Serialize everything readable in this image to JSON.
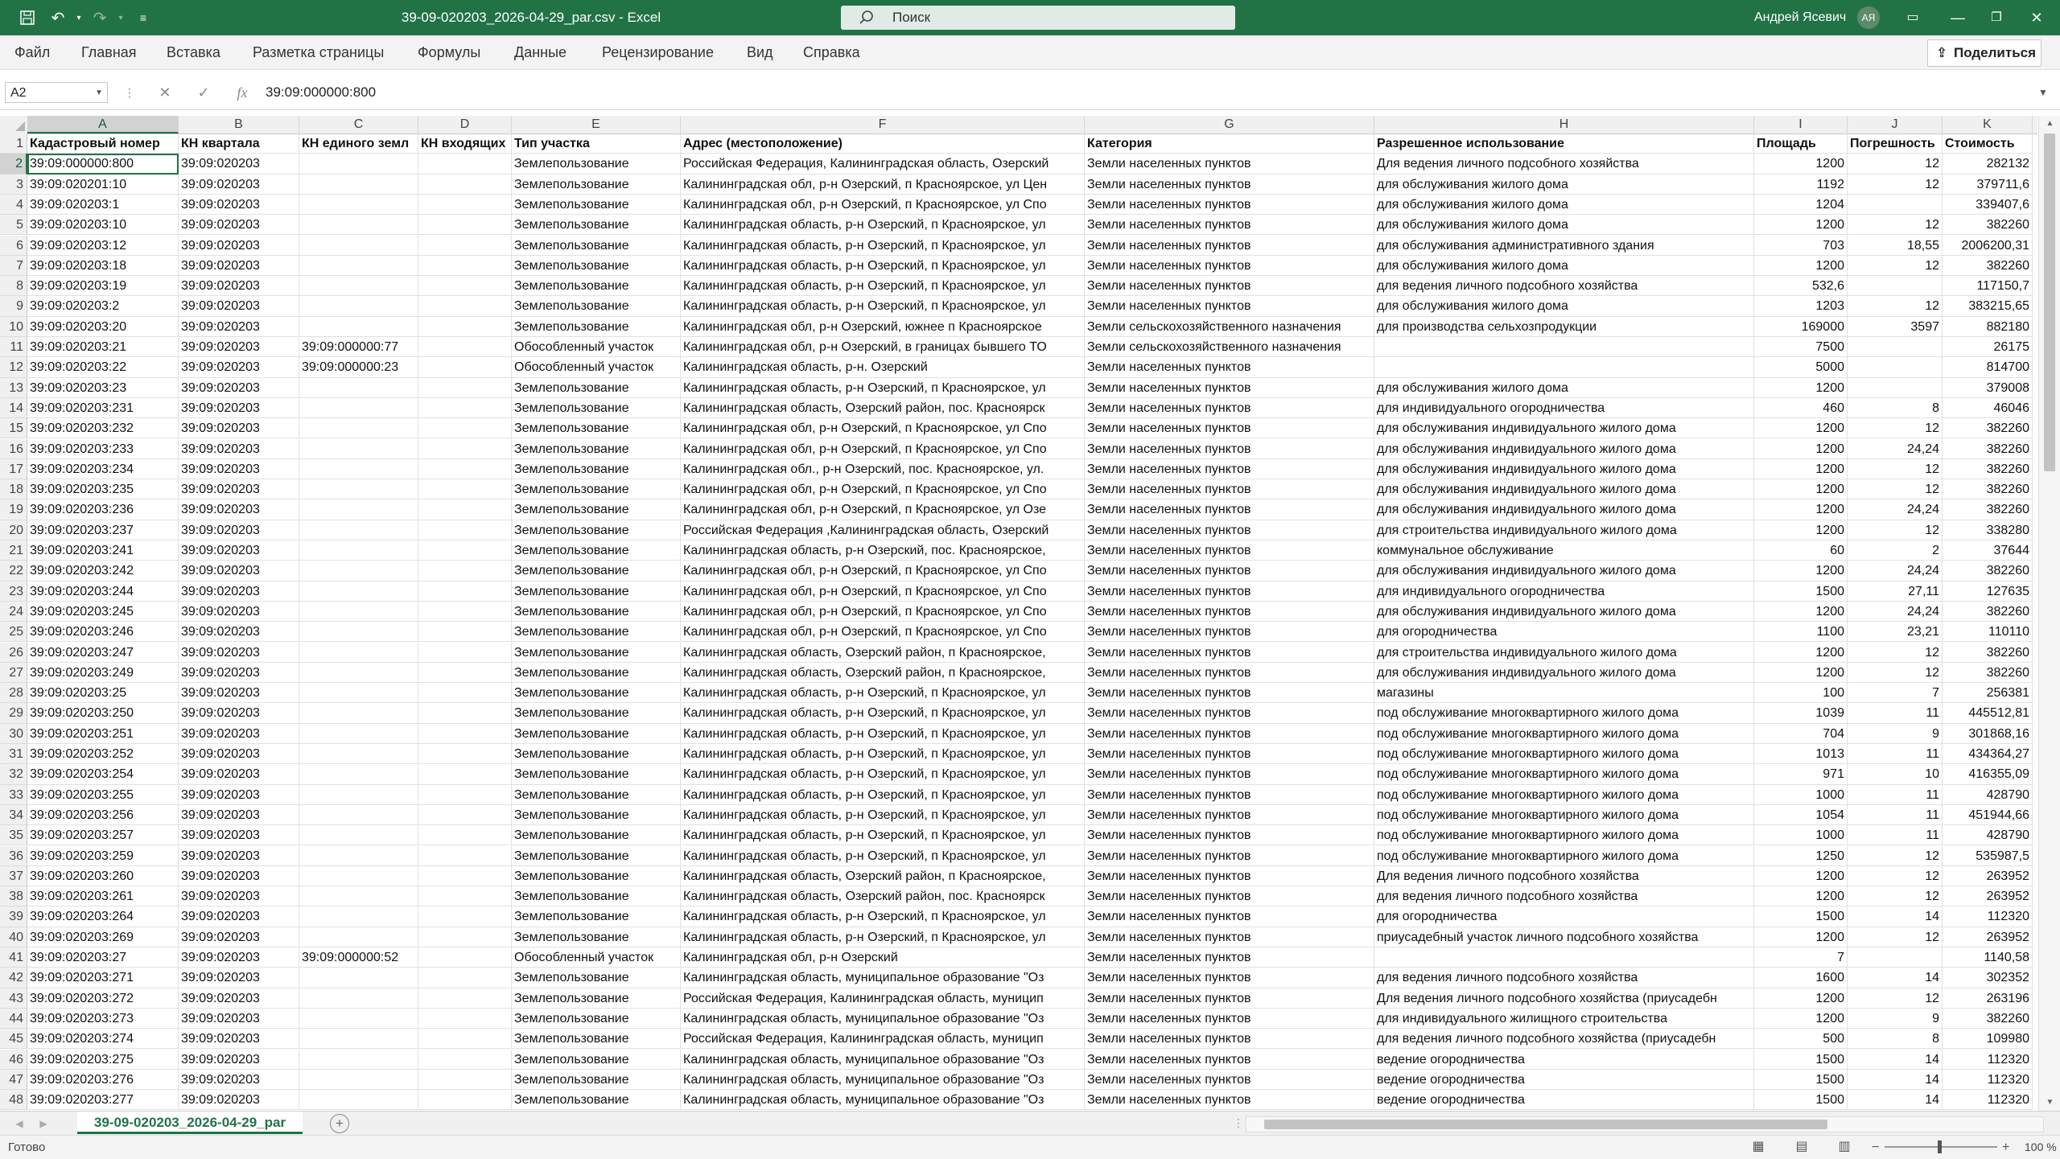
{
  "window": {
    "title": "39-09-020203_2026-04-29_par.csv  -  Excel",
    "search_placeholder": "Поиск",
    "user_name": "Андрей Ясевич",
    "user_initials": "АЯ"
  },
  "ribbon": {
    "tabs": [
      "Файл",
      "Главная",
      "Вставка",
      "Разметка страницы",
      "Формулы",
      "Данные",
      "Рецензирование",
      "Вид",
      "Справка"
    ],
    "share_label": "Поделиться"
  },
  "formula_bar": {
    "name_box": "A2",
    "formula": "39:09:000000:800"
  },
  "sheet": {
    "selected_cell": "A2",
    "columns": [
      {
        "letter": "A"
      },
      {
        "letter": "B"
      },
      {
        "letter": "C"
      },
      {
        "letter": "D"
      },
      {
        "letter": "E"
      },
      {
        "letter": "F"
      },
      {
        "letter": "G"
      },
      {
        "letter": "H"
      },
      {
        "letter": "I"
      },
      {
        "letter": "J"
      },
      {
        "letter": "K"
      }
    ],
    "header": [
      "Кадастровый номер",
      "КН квартала",
      "КН единого земл",
      "КН входящих",
      "Тип участка",
      "Адрес (местоположение)",
      "Категория",
      "Разрешенное использование",
      "Площадь",
      "Погрешность",
      "Стоимость"
    ],
    "rows": [
      [
        "39:09:000000:800",
        "39:09:020203",
        "",
        "",
        "Землепользование",
        "Российская Федерация, Калининградская область, Озерский",
        "Земли населенных пунктов",
        "Для ведения личного подсобного хозяйства",
        "1200",
        "12",
        "282132"
      ],
      [
        "39:09:020201:10",
        "39:09:020203",
        "",
        "",
        "Землепользование",
        "Калининградская обл, р-н Озерский, п Красноярское, ул Цен",
        "Земли населенных пунктов",
        "для обслуживания жилого дома",
        "1192",
        "12",
        "379711,6"
      ],
      [
        "39:09:020203:1",
        "39:09:020203",
        "",
        "",
        "Землепользование",
        "Калининградская обл, р-н Озерский, п Красноярское, ул Спо",
        "Земли населенных пунктов",
        "для обслуживания жилого дома",
        "1204",
        "",
        "339407,6"
      ],
      [
        "39:09:020203:10",
        "39:09:020203",
        "",
        "",
        "Землепользование",
        "Калининградская область, р-н Озерский, п Красноярское, ул",
        "Земли населенных пунктов",
        "для обслуживания жилого дома",
        "1200",
        "12",
        "382260"
      ],
      [
        "39:09:020203:12",
        "39:09:020203",
        "",
        "",
        "Землепользование",
        "Калининградская область, р-н Озерский, п Красноярское, ул",
        "Земли населенных пунктов",
        "для обслуживания административного здания",
        "703",
        "18,55",
        "2006200,31"
      ],
      [
        "39:09:020203:18",
        "39:09:020203",
        "",
        "",
        "Землепользование",
        "Калининградская область, р-н Озерский, п Красноярское, ул",
        "Земли населенных пунктов",
        "для обслуживания жилого дома",
        "1200",
        "12",
        "382260"
      ],
      [
        "39:09:020203:19",
        "39:09:020203",
        "",
        "",
        "Землепользование",
        "Калининградская область, р-н Озерский, п Красноярское, ул",
        "Земли населенных пунктов",
        "для ведения личного подсобного хозяйства",
        "532,6",
        "",
        "117150,7"
      ],
      [
        "39:09:020203:2",
        "39:09:020203",
        "",
        "",
        "Землепользование",
        "Калининградская область, р-н Озерский, п Красноярское, ул",
        "Земли населенных пунктов",
        "для обслуживания жилого дома",
        "1203",
        "12",
        "383215,65"
      ],
      [
        "39:09:020203:20",
        "39:09:020203",
        "",
        "",
        "Землепользование",
        "Калининградская обл, р-н Озерский, южнее п Красноярское",
        "Земли сельскохозяйственного назначения",
        "для производства сельхозпродукции",
        "169000",
        "3597",
        "882180"
      ],
      [
        "39:09:020203:21",
        "39:09:020203",
        "39:09:000000:77",
        "",
        "Обособленный участок",
        "Калининградская обл, р-н Озерский, в границах бывшего ТО",
        "Земли сельскохозяйственного назначения",
        "",
        "7500",
        "",
        "26175"
      ],
      [
        "39:09:020203:22",
        "39:09:020203",
        "39:09:000000:23",
        "",
        "Обособленный участок",
        "Калининградская область, р-н. Озерский",
        "Земли населенных пунктов",
        "",
        "5000",
        "",
        "814700"
      ],
      [
        "39:09:020203:23",
        "39:09:020203",
        "",
        "",
        "Землепользование",
        "Калининградская область, р-н Озерский, п Красноярское, ул",
        "Земли населенных пунктов",
        "для обслуживания жилого дома",
        "1200",
        "",
        "379008"
      ],
      [
        "39:09:020203:231",
        "39:09:020203",
        "",
        "",
        "Землепользование",
        "Калининградская область, Озерский район, пос. Красноярск",
        "Земли населенных пунктов",
        "для индивидуального огородничества",
        "460",
        "8",
        "46046"
      ],
      [
        "39:09:020203:232",
        "39:09:020203",
        "",
        "",
        "Землепользование",
        "Калининградская обл, р-н Озерский, п Красноярское, ул Спо",
        "Земли населенных пунктов",
        "для обслуживания индивидуального жилого дома",
        "1200",
        "12",
        "382260"
      ],
      [
        "39:09:020203:233",
        "39:09:020203",
        "",
        "",
        "Землепользование",
        "Калининградская обл, р-н Озерский, п Красноярское, ул Спо",
        "Земли населенных пунктов",
        "для обслуживания индивидуального жилого дома",
        "1200",
        "24,24",
        "382260"
      ],
      [
        "39:09:020203:234",
        "39:09:020203",
        "",
        "",
        "Землепользование",
        "Калининградская обл., р-н Озерский, пос. Красноярское, ул.",
        "Земли населенных пунктов",
        "для обслуживания индивидуального жилого дома",
        "1200",
        "12",
        "382260"
      ],
      [
        "39:09:020203:235",
        "39:09:020203",
        "",
        "",
        "Землепользование",
        "Калининградская обл, р-н Озерский, п Красноярское, ул Спо",
        "Земли населенных пунктов",
        "для обслуживания индивидуального жилого дома",
        "1200",
        "12",
        "382260"
      ],
      [
        "39:09:020203:236",
        "39:09:020203",
        "",
        "",
        "Землепользование",
        "Калининградская обл, р-н Озерский, п Красноярское, ул Озе",
        "Земли населенных пунктов",
        "для обслуживания индивидуального жилого дома",
        "1200",
        "24,24",
        "382260"
      ],
      [
        "39:09:020203:237",
        "39:09:020203",
        "",
        "",
        "Землепользование",
        "Российская Федерация ,Калининградская область, Озерский",
        "Земли населенных пунктов",
        "для строительства индивидуального жилого дома",
        "1200",
        "12",
        "338280"
      ],
      [
        "39:09:020203:241",
        "39:09:020203",
        "",
        "",
        "Землепользование",
        "Калининградская область, р-н Озерский, пос. Красноярское,",
        "Земли населенных пунктов",
        "коммунальное обслуживание",
        "60",
        "2",
        "37644"
      ],
      [
        "39:09:020203:242",
        "39:09:020203",
        "",
        "",
        "Землепользование",
        "Калининградская обл, р-н Озерский, п Красноярское, ул Спо",
        "Земли населенных пунктов",
        "для обслуживания индивидуального жилого дома",
        "1200",
        "24,24",
        "382260"
      ],
      [
        "39:09:020203:244",
        "39:09:020203",
        "",
        "",
        "Землепользование",
        "Калининградская обл, р-н Озерский, п Красноярское, ул Спо",
        "Земли населенных пунктов",
        "для индивидуального огородничества",
        "1500",
        "27,11",
        "127635"
      ],
      [
        "39:09:020203:245",
        "39:09:020203",
        "",
        "",
        "Землепользование",
        "Калининградская обл, р-н Озерский, п Красноярское, ул Спо",
        "Земли населенных пунктов",
        "для обслуживания индивидуального жилого дома",
        "1200",
        "24,24",
        "382260"
      ],
      [
        "39:09:020203:246",
        "39:09:020203",
        "",
        "",
        "Землепользование",
        "Калининградская обл, р-н Озерский, п Красноярское, ул Спо",
        "Земли населенных пунктов",
        "для огородничества",
        "1100",
        "23,21",
        "110110"
      ],
      [
        "39:09:020203:247",
        "39:09:020203",
        "",
        "",
        "Землепользование",
        "Калининградская область, Озерский район, п Красноярское,",
        "Земли населенных пунктов",
        "для строительства индивидуального жилого дома",
        "1200",
        "12",
        "382260"
      ],
      [
        "39:09:020203:249",
        "39:09:020203",
        "",
        "",
        "Землепользование",
        "Калининградская область, Озерский район, п Красноярское,",
        "Земли населенных пунктов",
        "для обслуживания индивидуального жилого дома",
        "1200",
        "12",
        "382260"
      ],
      [
        "39:09:020203:25",
        "39:09:020203",
        "",
        "",
        "Землепользование",
        "Калининградская область, р-н Озерский, п Красноярское, ул",
        "Земли населенных пунктов",
        "магазины",
        "100",
        "7",
        "256381"
      ],
      [
        "39:09:020203:250",
        "39:09:020203",
        "",
        "",
        "Землепользование",
        "Калининградская область, р-н Озерский, п Красноярское, ул",
        "Земли населенных пунктов",
        "под обслуживание многоквартирного жилого дома",
        "1039",
        "11",
        "445512,81"
      ],
      [
        "39:09:020203:251",
        "39:09:020203",
        "",
        "",
        "Землепользование",
        "Калининградская область, р-н Озерский, п Красноярское, ул",
        "Земли населенных пунктов",
        "под обслуживание многоквартирного жилого дома",
        "704",
        "9",
        "301868,16"
      ],
      [
        "39:09:020203:252",
        "39:09:020203",
        "",
        "",
        "Землепользование",
        "Калининградская область, р-н Озерский, п Красноярское, ул",
        "Земли населенных пунктов",
        "под обслуживание многоквартирного жилого дома",
        "1013",
        "11",
        "434364,27"
      ],
      [
        "39:09:020203:254",
        "39:09:020203",
        "",
        "",
        "Землепользование",
        "Калининградская область, р-н Озерский, п Красноярское, ул",
        "Земли населенных пунктов",
        "под обслуживание многоквартирного жилого дома",
        "971",
        "10",
        "416355,09"
      ],
      [
        "39:09:020203:255",
        "39:09:020203",
        "",
        "",
        "Землепользование",
        "Калининградская область, р-н Озерский, п Красноярское, ул",
        "Земли населенных пунктов",
        "под обслуживание многоквартирного жилого дома",
        "1000",
        "11",
        "428790"
      ],
      [
        "39:09:020203:256",
        "39:09:020203",
        "",
        "",
        "Землепользование",
        "Калининградская область, р-н Озерский, п Красноярское, ул",
        "Земли населенных пунктов",
        "под обслуживание многоквартирного жилого дома",
        "1054",
        "11",
        "451944,66"
      ],
      [
        "39:09:020203:257",
        "39:09:020203",
        "",
        "",
        "Землепользование",
        "Калининградская область, р-н Озерский, п Красноярское, ул",
        "Земли населенных пунктов",
        "под обслуживание многоквартирного жилого дома",
        "1000",
        "11",
        "428790"
      ],
      [
        "39:09:020203:259",
        "39:09:020203",
        "",
        "",
        "Землепользование",
        "Калининградская область, р-н Озерский, п Красноярское, ул",
        "Земли населенных пунктов",
        "под обслуживание многоквартирного жилого дома",
        "1250",
        "12",
        "535987,5"
      ],
      [
        "39:09:020203:260",
        "39:09:020203",
        "",
        "",
        "Землепользование",
        "Калининградская область, Озерский район, п Красноярское,",
        "Земли населенных пунктов",
        "Для ведения личного подсобного хозяйства",
        "1200",
        "12",
        "263952"
      ],
      [
        "39:09:020203:261",
        "39:09:020203",
        "",
        "",
        "Землепользование",
        "Калининградская область, Озерский район, пос. Красноярск",
        "Земли населенных пунктов",
        "для ведения личного подсобного хозяйства",
        "1200",
        "12",
        "263952"
      ],
      [
        "39:09:020203:264",
        "39:09:020203",
        "",
        "",
        "Землепользование",
        "Калининградская область, р-н Озерский, п Красноярское, ул",
        "Земли населенных пунктов",
        "для огородничества",
        "1500",
        "14",
        "112320"
      ],
      [
        "39:09:020203:269",
        "39:09:020203",
        "",
        "",
        "Землепользование",
        "Калининградская область, р-н Озерский, п Красноярское, ул",
        "Земли населенных пунктов",
        "приусадебный участок личного подсобного хозяйства",
        "1200",
        "12",
        "263952"
      ],
      [
        "39:09:020203:27",
        "39:09:020203",
        "39:09:000000:52",
        "",
        "Обособленный участок",
        "Калининградская обл, р-н Озерский",
        "Земли населенных пунктов",
        "",
        "7",
        "",
        "1140,58"
      ],
      [
        "39:09:020203:271",
        "39:09:020203",
        "",
        "",
        "Землепользование",
        "Калининградская область, муниципальное образование \"Оз",
        "Земли населенных пунктов",
        "для ведения личного подсобного хозяйства",
        "1600",
        "14",
        "302352"
      ],
      [
        "39:09:020203:272",
        "39:09:020203",
        "",
        "",
        "Землепользование",
        "Российская Федерация, Калининградская область, муницип",
        "Земли населенных пунктов",
        "Для ведения личного подсобного хозяйства (приусадебн",
        "1200",
        "12",
        "263196"
      ],
      [
        "39:09:020203:273",
        "39:09:020203",
        "",
        "",
        "Землепользование",
        "Калининградская область, муниципальное образование \"Оз",
        "Земли населенных пунктов",
        "для индивидуального жилищного строительства",
        "1200",
        "9",
        "382260"
      ],
      [
        "39:09:020203:274",
        "39:09:020203",
        "",
        "",
        "Землепользование",
        "Российская Федерация, Калининградская область, муницип",
        "Земли населенных пунктов",
        "для ведения личного подсобного хозяйства (приусадебн",
        "500",
        "8",
        "109980"
      ],
      [
        "39:09:020203:275",
        "39:09:020203",
        "",
        "",
        "Землепользование",
        "Калининградская область, муниципальное образование \"Оз",
        "Земли населенных пунктов",
        "ведение огородничества",
        "1500",
        "14",
        "112320"
      ],
      [
        "39:09:020203:276",
        "39:09:020203",
        "",
        "",
        "Землепользование",
        "Калининградская область, муниципальное образование \"Оз",
        "Земли населенных пунктов",
        "ведение огородничества",
        "1500",
        "14",
        "112320"
      ],
      [
        "39:09:020203:277",
        "39:09:020203",
        "",
        "",
        "Землепользование",
        "Калининградская область, муниципальное образование \"Оз",
        "Земли населенных пунктов",
        "ведение огородничества",
        "1500",
        "14",
        "112320"
      ]
    ],
    "tab_name": "39-09-020203_2026-04-29_par"
  },
  "status_bar": {
    "status": "Готово",
    "zoom": "100 %"
  },
  "colors": {
    "brand": "#217346"
  }
}
